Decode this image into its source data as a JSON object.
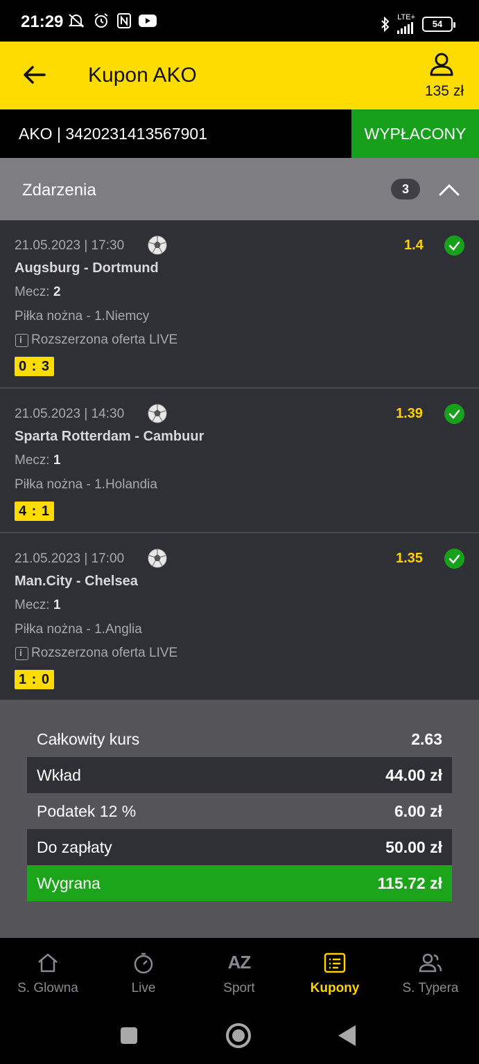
{
  "status_bar": {
    "time": "21:29",
    "network": "LTE+",
    "battery": "54",
    "left_icons": [
      "muted-bell-icon",
      "alarm-icon",
      "nfc-icon",
      "youtube-icon"
    ],
    "right_icons": [
      "bluetooth-icon",
      "signal-icon",
      "battery-icon"
    ]
  },
  "app_bar": {
    "title": "Kupon AKO",
    "balance": "135 zł"
  },
  "ticket": {
    "id": "AKO | 3420231413567901",
    "status": "WYPŁACONY",
    "status_color": "#16a01c"
  },
  "events_section": {
    "title": "Zdarzenia",
    "count": "3"
  },
  "events": [
    {
      "date": "21.05.2023 | 17:30",
      "odds": "1.4",
      "match": "Augsburg - Dortmund",
      "bet_label": "Mecz:",
      "bet_value": "2",
      "league": "Piłka nożna - 1.Niemcy",
      "live": "Rozszerzona oferta LIVE",
      "score": "0 : 3"
    },
    {
      "date": "21.05.2023 | 14:30",
      "odds": "1.39",
      "match": "Sparta Rotterdam - Cambuur",
      "bet_label": "Mecz:",
      "bet_value": "1",
      "league": "Piłka nożna - 1.Holandia",
      "live": "",
      "score": "4 : 1"
    },
    {
      "date": "21.05.2023 | 17:00",
      "odds": "1.35",
      "match": "Man.City - Chelsea",
      "bet_label": "Mecz:",
      "bet_value": "1",
      "league": "Piłka nożna - 1.Anglia",
      "live": "Rozszerzona oferta LIVE",
      "score": "1 : 0"
    }
  ],
  "summary": {
    "total_odds_label": "Całkowity kurs",
    "total_odds": "2.63",
    "stake_label": "Wkład",
    "stake": "44.00 zł",
    "tax_label": "Podatek 12 %",
    "tax": "6.00 zł",
    "to_pay_label": "Do zapłaty",
    "to_pay": "50.00 zł",
    "win_label": "Wygrana",
    "win": "115.72 zł"
  },
  "bottom_nav": [
    {
      "label": "S. Glowna",
      "icon": "home-icon",
      "active": false
    },
    {
      "label": "Live",
      "icon": "stopwatch-icon",
      "active": false
    },
    {
      "label": "Sport",
      "icon": "az-icon",
      "active": false
    },
    {
      "label": "Kupony",
      "icon": "coupon-icon",
      "active": true
    },
    {
      "label": "S. Typera",
      "icon": "users-icon",
      "active": false
    }
  ],
  "colors": {
    "brand_yellow": "#ffdc00",
    "odds_yellow": "#ffd200",
    "success_green": "#16a01c",
    "background": "#2f2f36"
  }
}
